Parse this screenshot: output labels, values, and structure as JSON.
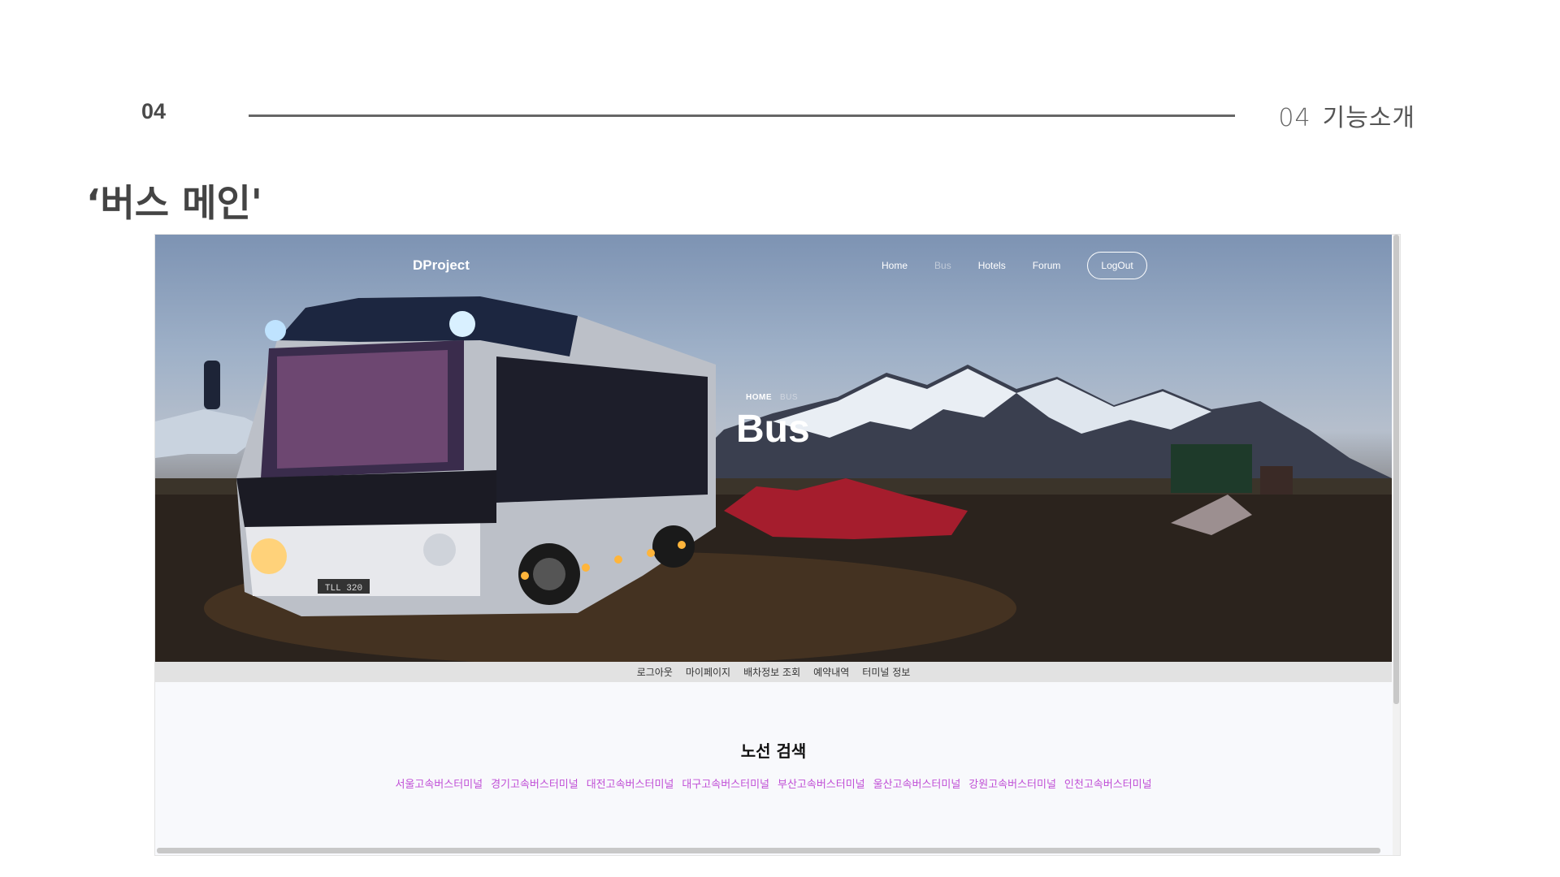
{
  "slide": {
    "number": "04",
    "section_number": "04",
    "section_title": "기능소개",
    "page_title": "‘버스 메인'"
  },
  "site": {
    "brand": "DProject",
    "nav": [
      {
        "label": "Home",
        "active": false
      },
      {
        "label": "Bus",
        "active": true
      },
      {
        "label": "Hotels",
        "active": false
      },
      {
        "label": "Forum",
        "active": false
      }
    ],
    "logout_label": "LogOut",
    "breadcrumb": {
      "home": "HOME",
      "current": "BUS"
    },
    "hero_title": "Bus",
    "subnav": [
      "로그아웃",
      "마이페이지",
      "배차정보 조회",
      "예약내역",
      "터미널 정보"
    ],
    "route_search_title": "노선 검색",
    "terminals": [
      "서울고속버스터미널",
      "경기고속버스터미널",
      "대전고속버스터미널",
      "대구고속버스터미널",
      "부산고속버스터미널",
      "울산고속버스터미널",
      "강원고속버스터미널",
      "인천고속버스터미널"
    ],
    "plate_text": "TLL 320"
  },
  "colors": {
    "terminal_link": "#c04fd6",
    "subnav_bg": "#e2e2e2",
    "rule": "#666666"
  }
}
